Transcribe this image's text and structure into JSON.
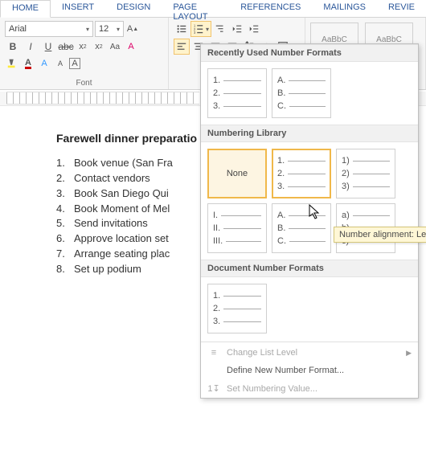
{
  "tabs": {
    "items": [
      "HOME",
      "INSERT",
      "DESIGN",
      "PAGE LAYOUT",
      "REFERENCES",
      "MAILINGS",
      "REVIE"
    ],
    "active_index": 0
  },
  "ribbon": {
    "font_name": "Arial",
    "font_size": "12",
    "group_font_label": "Font"
  },
  "document": {
    "title": "Farewell dinner preparatio",
    "items": [
      "Book venue (San Fra",
      "Contact vendors",
      "Book San Diego Qui",
      "Book Moment of Mel",
      "Send invitations",
      "Approve location set",
      "Arrange seating plac",
      "Set up podium"
    ]
  },
  "dropdown": {
    "section_recent": "Recently Used Number Formats",
    "section_library": "Numbering Library",
    "section_document": "Document Number Formats",
    "none_label": "None",
    "swatches_recent": [
      {
        "labels": [
          "1.",
          "2.",
          "3."
        ]
      },
      {
        "labels": [
          "A.",
          "B.",
          "C."
        ]
      }
    ],
    "swatches_library": [
      {
        "none": true
      },
      {
        "labels": [
          "1.",
          "2.",
          "3."
        ],
        "hovered": true
      },
      {
        "labels": [
          "1)",
          "2)",
          "3)"
        ]
      },
      {
        "labels": [
          "I.",
          "II.",
          "III."
        ]
      },
      {
        "labels": [
          "A.",
          "B.",
          "C."
        ]
      },
      {
        "labels": [
          "a)",
          "b)",
          "c)"
        ]
      }
    ],
    "swatches_document": [
      {
        "labels": [
          "1.",
          "2.",
          "3."
        ]
      }
    ],
    "menu": {
      "change_level": "Change List Level",
      "define_new": "Define New Number Format...",
      "set_value": "Set Numbering Value..."
    }
  },
  "tooltip": "Number alignment: Left"
}
